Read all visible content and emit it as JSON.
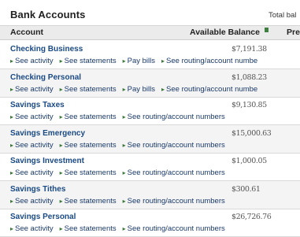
{
  "header": {
    "title": "Bank Accounts",
    "total_label": "Total bal"
  },
  "columns": {
    "account": "Account",
    "balance": "Available Balance",
    "pre": "Pre"
  },
  "accounts": [
    {
      "name": "Checking Business",
      "balance": "$7,191.38",
      "links": [
        "See activity",
        "See statements",
        "Pay bills",
        "See routing/account numbe"
      ]
    },
    {
      "name": "Checking Personal",
      "balance": "$1,088.23",
      "links": [
        "See activity",
        "See statements",
        "Pay bills",
        "See routing/account numbe"
      ]
    },
    {
      "name": "Savings Taxes",
      "balance": "$9,130.85",
      "links": [
        "See activity",
        "See statements",
        "See routing/account numbers"
      ]
    },
    {
      "name": "Savings Emergency",
      "balance": "$15,000.63",
      "links": [
        "See activity",
        "See statements",
        "See routing/account numbers"
      ]
    },
    {
      "name": "Savings Investment",
      "balance": "$1,000.05",
      "links": [
        "See activity",
        "See statements",
        "See routing/account numbers"
      ]
    },
    {
      "name": "Savings Tithes",
      "balance": "$300.61",
      "links": [
        "See activity",
        "See statements",
        "See routing/account numbers"
      ]
    },
    {
      "name": "Savings Personal",
      "balance": "$26,726.76",
      "links": [
        "See activity",
        "See statements",
        "See routing/account numbers"
      ]
    }
  ]
}
